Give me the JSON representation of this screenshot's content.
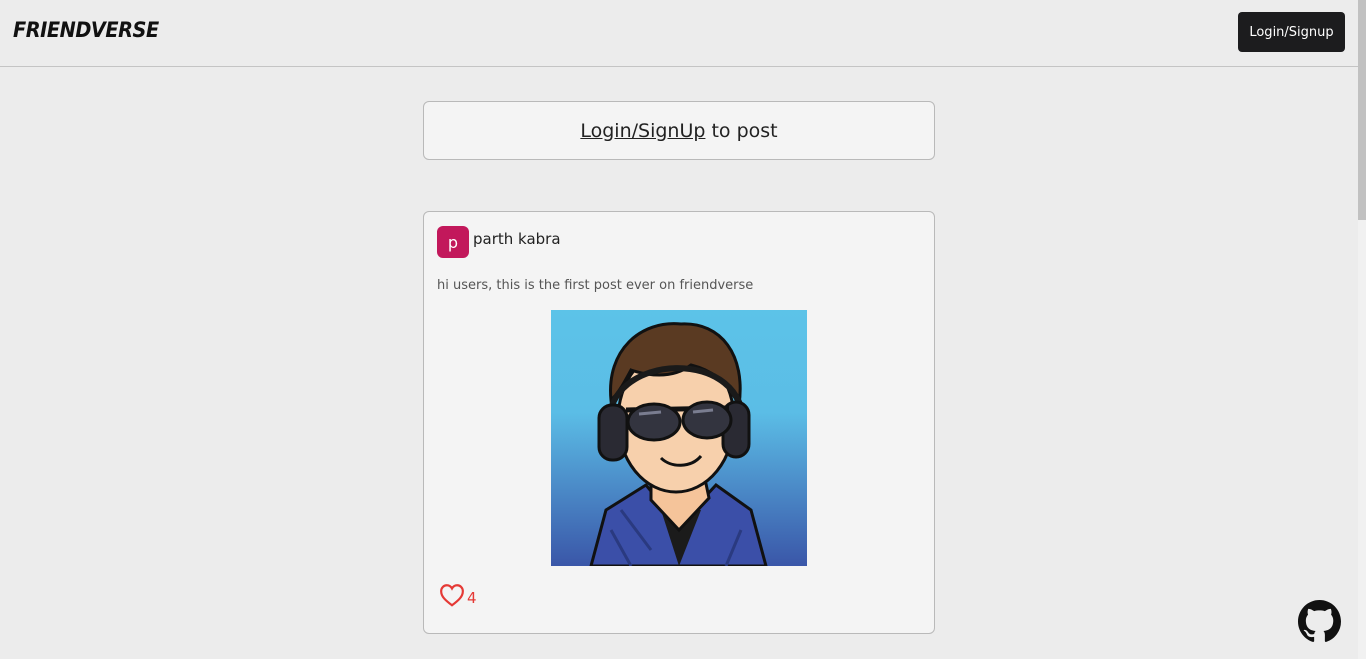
{
  "navbar": {
    "logo": "FRIENDVERSE",
    "login_button": "Login/Signup"
  },
  "login_prompt": {
    "link_text": "Login/SignUp",
    "suffix": " to post"
  },
  "post": {
    "avatar_letter": "p",
    "author": "parth kabra",
    "text": "hi users, this is the first post ever on friendverse",
    "likes": "4"
  },
  "icons": {
    "like": "heart-outline-icon",
    "github": "github-icon"
  },
  "colors": {
    "avatar_bg": "#c2185b",
    "like_color": "#e53935",
    "button_bg": "#1c1c1e"
  }
}
